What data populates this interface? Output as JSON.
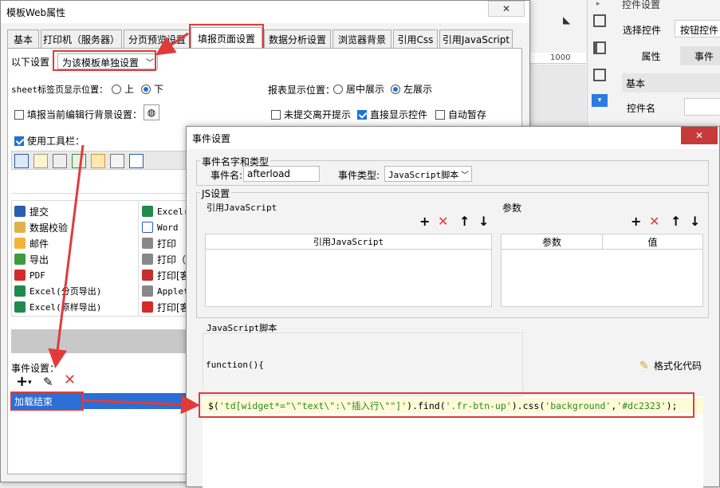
{
  "bg": {
    "ruler_label": "1000",
    "right_panel": {
      "title": "控件设置",
      "select_label": "选择控件",
      "select_value": "按钮控件",
      "tab_attr": "属性",
      "tab_event": "事件",
      "section_basic": "基本",
      "field_name": "控件名"
    }
  },
  "main_window": {
    "title": "模板Web属性",
    "close_glyph": "✕",
    "tabs": [
      "基本",
      "打印机（服务器）",
      "分页预览设置",
      "填报页面设置",
      "数据分析设置",
      "浏览器背景",
      "引用Css",
      "引用JavaScript"
    ],
    "active_tab": 3,
    "setting_label": "以下设置",
    "setting_value": "为该模板单独设置",
    "sheet_pos_label": "sheet标签页显示位置：",
    "sheet_up": "上",
    "sheet_down": "下",
    "report_pos_label": "报表显示位置：",
    "report_center": "居中展示",
    "report_left": "左展示",
    "fill_bg_label": "填报当前编辑行背景设置：",
    "no_submit_tip": "未提交离开提示",
    "direct_show": "直接显示控件",
    "auto_save": "自动暂存",
    "use_toolbar": "使用工具栏：",
    "buttons_left": [
      "提交",
      "数据校验",
      "邮件",
      "导出",
      "PDF",
      "Excel(分页导出)",
      "Excel(原样导出)"
    ],
    "buttons_right": [
      "Excel(分",
      "Word",
      "打印",
      "打印（客",
      "打印[客",
      "Applet打",
      "打印[客"
    ],
    "event_label": "事件设置：",
    "event_item": "加载结束"
  },
  "dialog": {
    "title": "事件设置",
    "close_glyph": "✕",
    "group_event": "事件名字和类型",
    "event_name_label": "事件名:",
    "event_name_value": "afterload",
    "event_type_label": "事件类型:",
    "event_type_value": "JavaScript脚本",
    "group_js": "JS设置",
    "ref_js_label": "引用JavaScript",
    "param_label": "参数",
    "col_ref_js": "引用JavaScript",
    "col_param": "参数",
    "col_value": "值",
    "script_label": "JavaScript脚本",
    "func_text": "function(){",
    "format_code": "格式化代码",
    "code_parts": {
      "p1": "$(",
      "s1": "'td[widget*=\"\\\"text\\\":\\\"插入行\\\"\"]'",
      "p2": ").find(",
      "s2": "'.fr-btn-up'",
      "p3": ").css(",
      "s3": "'background'",
      "p4": ",",
      "s4": "'#dc2323'",
      "p5": ");"
    }
  },
  "colors": {
    "accent_red": "#e23a3a",
    "select_blue": "#2a6fd6",
    "code_string": "#2a8a2a"
  }
}
